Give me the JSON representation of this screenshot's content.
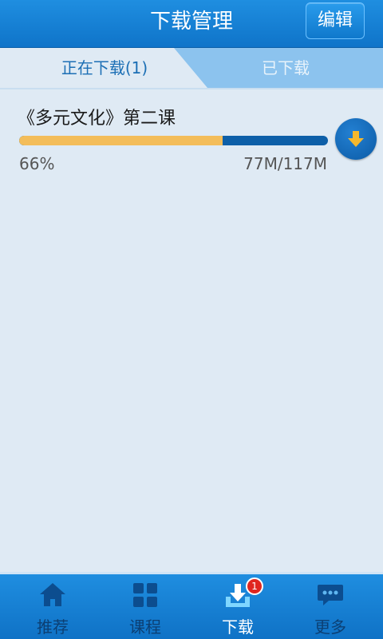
{
  "header": {
    "title": "下载管理",
    "edit_label": "编辑"
  },
  "tabs": {
    "active_label": "正在下载(1)",
    "inactive_label": "已下载"
  },
  "downloads": [
    {
      "title": "《多元文化》第二课",
      "percent_text": "66%",
      "progress": 0.66,
      "size_text": "77M/117M",
      "action_icon": "download-arrow-icon"
    }
  ],
  "nav": {
    "items": [
      {
        "label": "推荐",
        "icon": "home-icon"
      },
      {
        "label": "课程",
        "icon": "grid-icon"
      },
      {
        "label": "下载",
        "icon": "download-tray-icon",
        "badge": "1"
      },
      {
        "label": "更多",
        "icon": "chat-bubble-icon"
      }
    ],
    "active_index": 2
  },
  "colors": {
    "header_blue": "#1b86d9",
    "progress_done": "#f3bd5a",
    "progress_remaining": "#0d5fa8",
    "badge_red": "#e0261f"
  }
}
